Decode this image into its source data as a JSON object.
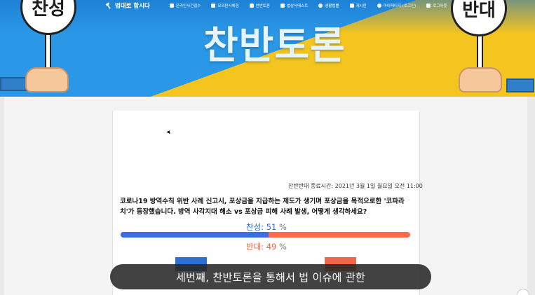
{
  "nav": {
    "logo": "법대로 합시다",
    "items": [
      {
        "label": "온라인사건접수",
        "icon": "document-icon"
      },
      {
        "label": "모의판사체험",
        "icon": "judge-icon"
      },
      {
        "label": "찬반토론",
        "icon": "debate-icon"
      },
      {
        "label": "법상식테스트",
        "icon": "quiz-icon"
      },
      {
        "label": "생활법률",
        "icon": "book-icon"
      },
      {
        "label": "게시판",
        "icon": "board-icon"
      },
      {
        "label": "마이페이지 (로그인)",
        "icon": "user-icon"
      },
      {
        "label": "로그아웃",
        "icon": "logout-icon"
      }
    ]
  },
  "banner": {
    "title": "찬반토론",
    "sign_left": "찬성",
    "sign_right": "반대"
  },
  "debate": {
    "deadline": "찬반반대 종료시간: 2021년 3월 1일 월요일 오전 11:00",
    "question": "코로나19 방역수칙 위반 사례 신고시, 포상금을 지급하는 제도가 생기며 포상금을 목적으로한 '코파라치'가 등장했습니다. 방역 사각지대 해소 vs 포상금 피해 사례 발생, 어떻게 생각하세요?",
    "yes_label": "찬성: ",
    "yes_value": "51",
    "no_label": "반대: ",
    "no_value": "49",
    "percent_symbol": "%",
    "yes_fraction": 0.51,
    "colors": {
      "yes": "#3b6ee3",
      "no": "#f0643f"
    }
  },
  "caption": "세번째, 찬반토론을 통해서 법 이슈에 관한"
}
